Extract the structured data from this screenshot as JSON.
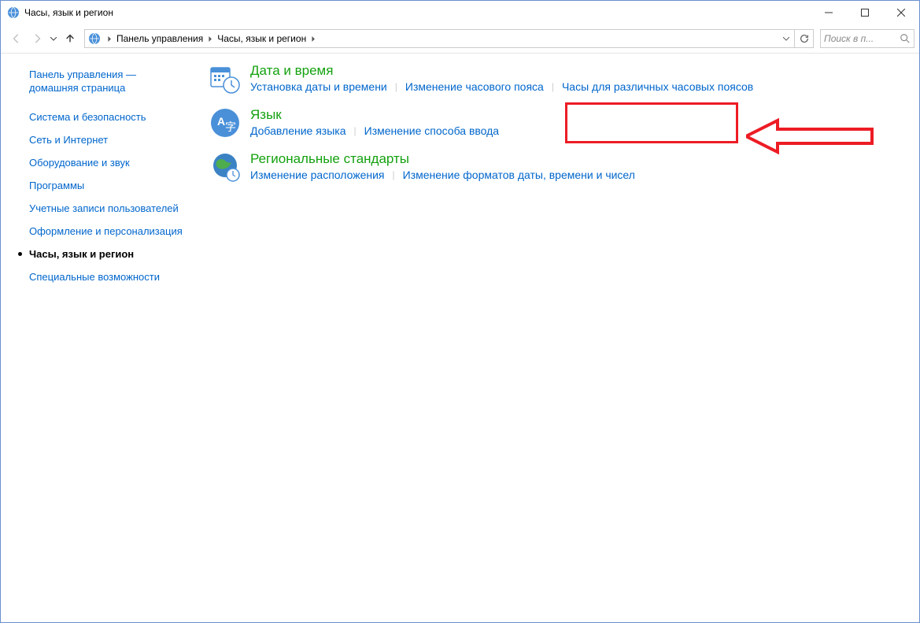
{
  "window": {
    "title": "Часы, язык и регион"
  },
  "breadcrumb": {
    "root": "Панель управления",
    "current": "Часы, язык и регион"
  },
  "search": {
    "placeholder": "Поиск в п..."
  },
  "sidebar": {
    "home": "Панель управления — домашняя страница",
    "items": [
      "Система и безопасность",
      "Сеть и Интернет",
      "Оборудование и звук",
      "Программы",
      "Учетные записи пользователей",
      "Оформление и персонализация",
      "Часы, язык и регион",
      "Специальные возможности"
    ],
    "active_index": 6
  },
  "categories": [
    {
      "icon": "clock-calendar",
      "title": "Дата и время",
      "links": [
        "Установка даты и времени",
        "Изменение часового пояса",
        "Часы для различных часовых поясов"
      ]
    },
    {
      "icon": "language",
      "title": "Язык",
      "links": [
        "Добавление языка",
        "Изменение способа ввода"
      ]
    },
    {
      "icon": "region-globe",
      "title": "Региональные стандарты",
      "links": [
        "Изменение расположения",
        "Изменение форматов даты, времени и чисел"
      ]
    }
  ]
}
